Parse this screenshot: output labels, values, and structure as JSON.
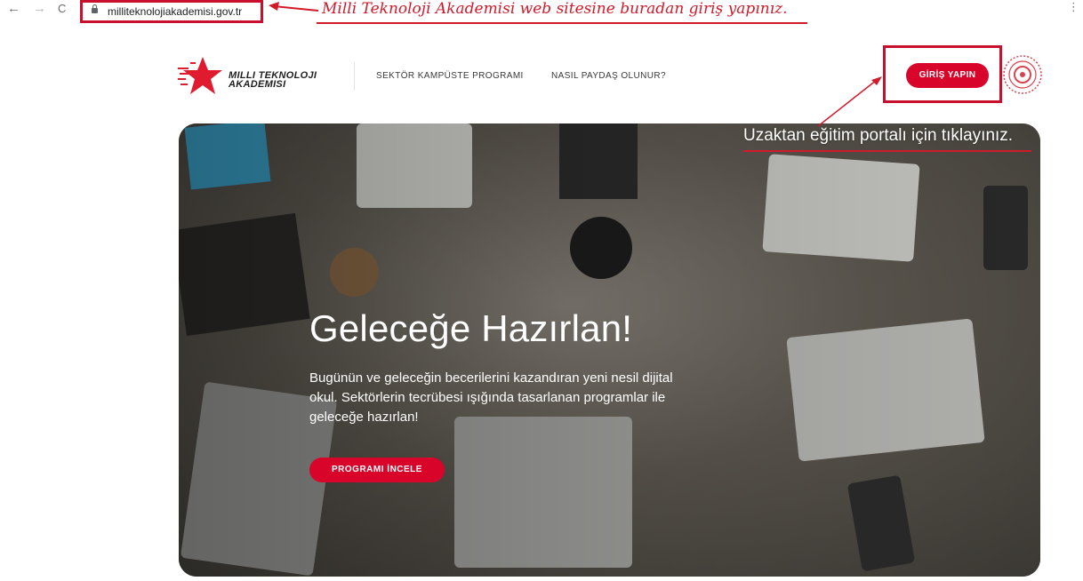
{
  "browser": {
    "back_icon": "←",
    "forward_icon": "→",
    "reload_icon": "C",
    "url": "milliteknolojiakademisi.gov.tr",
    "menu_icon": "⋮"
  },
  "annotations": {
    "top_note": "Milli Teknoloji Akademisi web sitesine buradan giriş yapınız.",
    "login_note": "Uzaktan eğitim portalı için tıklayınız.",
    "annotation_color": "#d11a2a"
  },
  "header": {
    "logo_line1": "MILLI TEKNOLOJI",
    "logo_line2": "AKADEMISI",
    "nav": [
      "SEKTÖR KAMPÜSTE PROGRAMI",
      "NASIL PAYDAŞ OLUNUR?"
    ],
    "login_label": "GİRİŞ YAPIN",
    "accent": "#d90429"
  },
  "hero": {
    "title": "Geleceğe Hazırlan!",
    "description": "Bugünün ve geleceğin becerilerini kazandıran yeni nesil dijital okul. Sektörlerin tecrübesi ışığında tasarlanan programlar ile geleceğe hazırlan!",
    "cta_label": "PROGRAMI İNCELE"
  }
}
